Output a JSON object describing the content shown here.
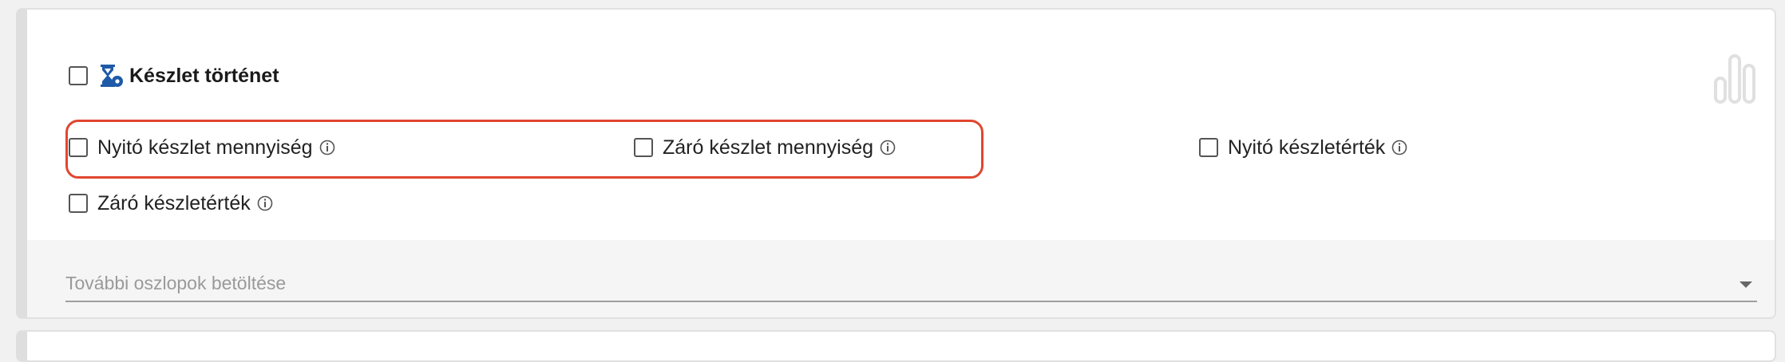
{
  "section": {
    "title": "Készlet történet",
    "icon": "hourglass-gear-icon",
    "chart_icon": "bar-chart-icon"
  },
  "options": [
    {
      "label": "Nyitó készlet mennyiség",
      "checked": false,
      "info_icon": "info-icon"
    },
    {
      "label": "Záró készlet mennyiség",
      "checked": false,
      "info_icon": "info-icon"
    },
    {
      "label": "Nyitó készletérték",
      "checked": false,
      "info_icon": "info-icon"
    },
    {
      "label": "Záró készletérték",
      "checked": false,
      "info_icon": "info-icon"
    }
  ],
  "load_columns": {
    "placeholder": "További oszlopok betöltése"
  },
  "colors": {
    "highlight": "#e0462f",
    "icon_blue": "#1e5aa8",
    "chart_icon": "#e0e0e0"
  }
}
